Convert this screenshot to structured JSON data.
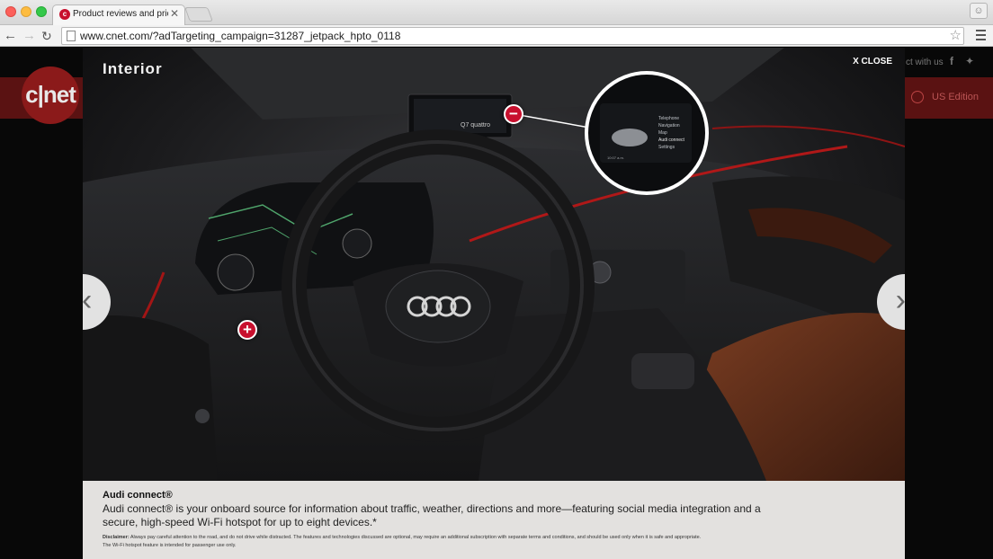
{
  "browser": {
    "tab_title": "Product reviews and prices",
    "tab_favicon": "c",
    "tab_close": "✕",
    "url": "www.cnet.com/?adTargeting_campaign=31287_jetpack_hpto_0118"
  },
  "site": {
    "logo": "c|net",
    "connect_text": "ct with us",
    "edition": "US Edition"
  },
  "overlay": {
    "title": "Interior",
    "close_label": "X CLOSE",
    "hotspot_minus": "−",
    "hotspot_plus": "+",
    "prev": "‹",
    "next": "›",
    "screen_model": "Q7 quattro",
    "callout_items": [
      "Telephone",
      "Navigation",
      "Map",
      "Audi connect",
      "Settings"
    ],
    "callout_time": "10:07 a.m.",
    "caption_title": "Audi connect®",
    "caption_body": "Audi connect® is your onboard source for information about traffic, weather, directions and more—featuring social media integration and a secure, high-speed Wi-Fi hotspot for up to eight devices.*",
    "disclaimer_label": "Disclaimer:",
    "disclaimer_text": "Always pay careful attention to the road, and do not drive while distracted. The features and technologies discussed are optional, may require an additional subscription with separate terms and conditions, and should be used only when it is safe and appropriate.",
    "disclaimer_text2": "The Wi-Fi hotspot feature is intended for passenger use only."
  },
  "colors": {
    "accent_red": "#c8102e",
    "cnet_red": "#8b1a1a"
  }
}
